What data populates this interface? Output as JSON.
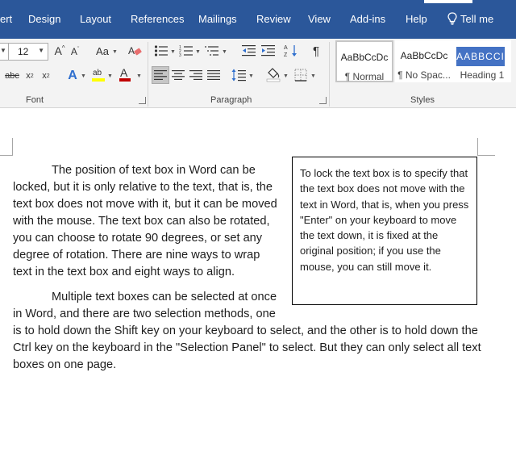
{
  "tabs": {
    "insert_partial": "ert",
    "design": "Design",
    "layout": "Layout",
    "references": "References",
    "mailings": "Mailings",
    "review": "Review",
    "view": "View",
    "addins": "Add-ins",
    "help": "Help",
    "tellme": "Tell me"
  },
  "ribbon": {
    "font_size": "12",
    "groups": {
      "font": "Font",
      "paragraph": "Paragraph",
      "styles": "Styles"
    },
    "styles": [
      {
        "preview": "AaBbCcDc",
        "name": "¶ Normal",
        "selected": true
      },
      {
        "preview": "AaBbCcDc",
        "name": "¶ No Spac...",
        "selected": false
      },
      {
        "preview": "AABBCCI",
        "name": "Heading 1",
        "selected": false
      }
    ],
    "colors": {
      "tab_bar": "#2b579a",
      "highlight": "#ffff00",
      "font_color": "#c00000",
      "heading_bg": "#4472c4",
      "text_effects": "#2f6fce"
    },
    "icons": [
      "grow-font",
      "shrink-font",
      "change-case",
      "clear-formatting",
      "bullets",
      "numbering",
      "multilevel-list",
      "decrease-indent",
      "increase-indent",
      "sort",
      "show-hide",
      "strikethrough",
      "subscript",
      "superscript",
      "text-effects",
      "highlight",
      "font-color",
      "align-left",
      "center",
      "align-right",
      "justify",
      "line-spacing",
      "shading",
      "borders"
    ]
  },
  "document": {
    "paragraph1": "The position of text box in Word can be locked, but it is only relative to the text, that is, the text box does not move with it, but it can be moved with the mouse. The text box can also be rotated, you can choose to rotate 90 degrees, or set any degree of rotation. There are nine ways to wrap text in the text box and eight ways to align.",
    "paragraph2": "Multiple text boxes can be selected at once in Word, and there are two selection methods, one is to hold down the Shift key on your keyboard to select, and the other is to hold down the Ctrl key on the keyboard in the \"Selection Panel\" to select. But they can only select all text boxes on one page.",
    "textbox": "To lock the text box is to specify that the text box does not move with the text in Word, that is, when you press \"Enter\" on your keyboard to move the text down, it is fixed at the original position; if you use the mouse, you can still move it."
  }
}
